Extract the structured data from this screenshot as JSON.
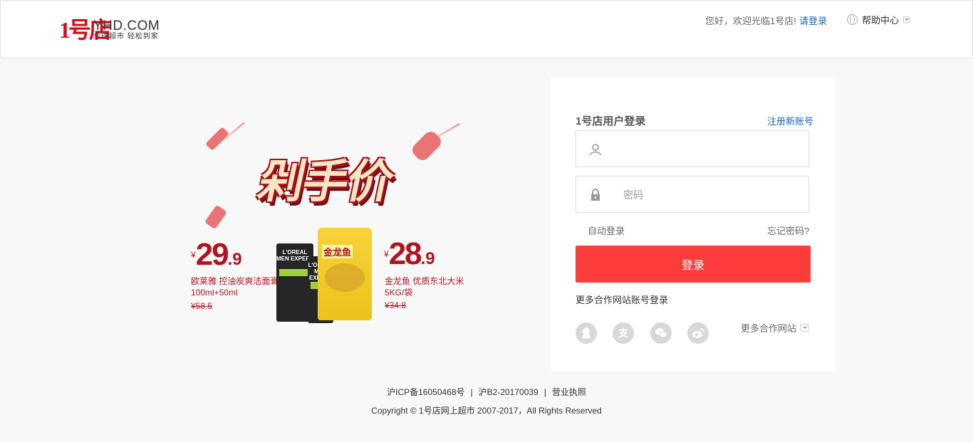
{
  "header": {
    "logo_mark": "1号店",
    "logo_brand": "YHD.COM",
    "logo_slogan": "全球超市 轻松到家",
    "welcome": "您好，欢迎光临1号店!",
    "login_link": "请登录",
    "help": "帮助中心"
  },
  "promo": {
    "banner_title": "剁手价",
    "left_product": {
      "yen": "¥",
      "price_int": "29",
      "price_dec": ".9",
      "name_line1": "欧莱雅 控油炭爽洁面膏",
      "name_line2": "100ml+50ml",
      "old_price": "¥58.5"
    },
    "right_product": {
      "yen": "¥",
      "price_int": "28",
      "price_dec": ".9",
      "name_line1": "金龙鱼 优质东北大米",
      "name_line2": "5KG/袋",
      "old_price": "¥34.8"
    },
    "tube_label": "L'OREAL MEN EXPERT",
    "rice_label": "金龙鱼"
  },
  "login": {
    "title": "1号店用户登录",
    "register": "注册新账号",
    "username_placeholder": "",
    "password_placeholder": "密码",
    "auto_login": "自动登录",
    "forgot": "忘记密码?",
    "submit": "登录",
    "partner_title": "更多合作网站账号登录",
    "more_sites": "更多合作网站",
    "social_icons": [
      "qq-icon",
      "alipay-icon",
      "wechat-icon",
      "weibo-icon"
    ]
  },
  "footer": {
    "icp": "沪ICP备16050468号",
    "b2": "沪B2-20170039",
    "license": "营业执照",
    "copyright": "Copyright © 1号店网上超市 2007-2017，All Rights Reserved"
  },
  "colors": {
    "accent_red": "#ff3c3c",
    "link_blue": "#1a66b3",
    "promo_red": "#b01420"
  }
}
